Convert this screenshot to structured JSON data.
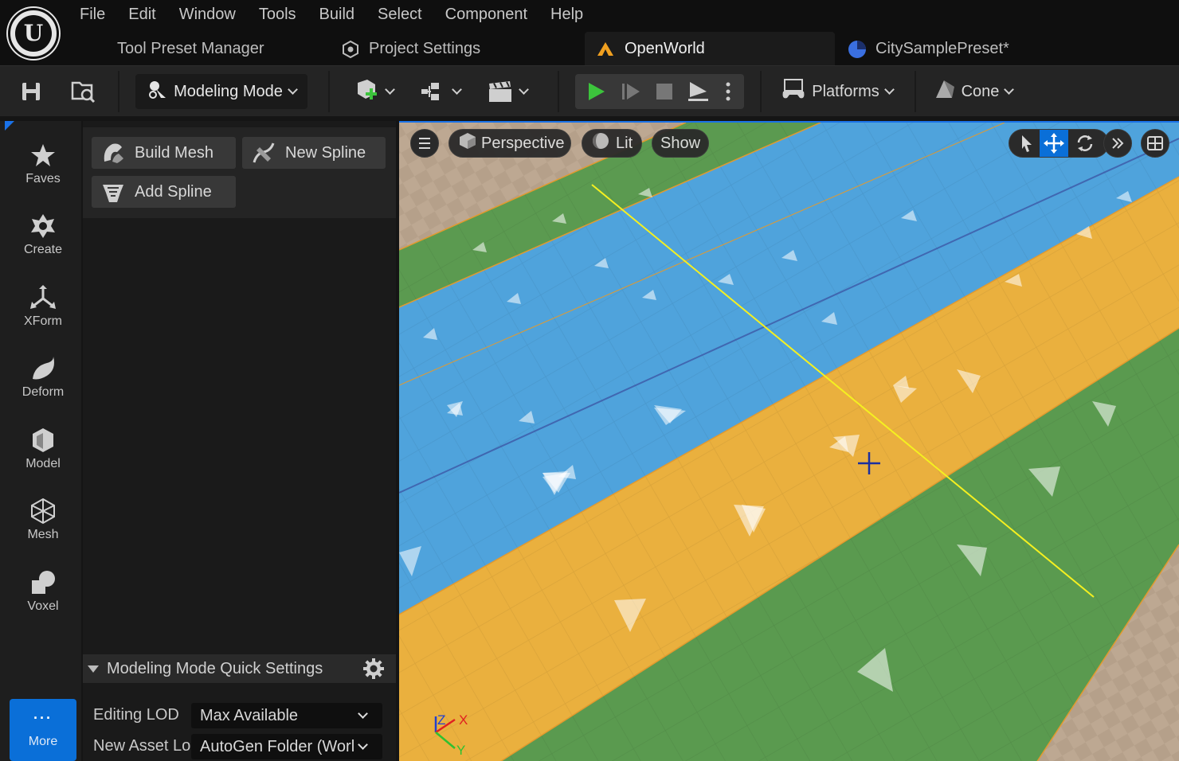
{
  "menu": [
    "File",
    "Edit",
    "Window",
    "Tools",
    "Build",
    "Select",
    "Component",
    "Help"
  ],
  "tabs": [
    {
      "label": "Tool Preset Manager",
      "icon": "none"
    },
    {
      "label": "Project Settings",
      "icon": "settings-cube-icon"
    },
    {
      "label": "OpenWorld",
      "icon": "level-icon",
      "active": true
    },
    {
      "label": "CitySamplePreset*",
      "icon": "preset-icon"
    }
  ],
  "toolbar": {
    "mode_label": "Modeling Mode",
    "platforms_label": "Platforms",
    "cone_label": "Cone",
    "play_color": "#3cc43c"
  },
  "categories": [
    {
      "label": "Faves",
      "icon": "star-icon"
    },
    {
      "label": "Create",
      "icon": "create-icon"
    },
    {
      "label": "XForm",
      "icon": "xform-icon"
    },
    {
      "label": "Deform",
      "icon": "deform-icon"
    },
    {
      "label": "Model",
      "icon": "model-icon"
    },
    {
      "label": "Mesh",
      "icon": "mesh-icon"
    },
    {
      "label": "Voxel",
      "icon": "voxel-icon"
    }
  ],
  "more_label": "More",
  "tools": [
    {
      "label": "Build Mesh"
    },
    {
      "label": "New Spline"
    },
    {
      "label": "Add Spline"
    }
  ],
  "quick_settings": {
    "title": "Modeling Mode Quick Settings",
    "editing_lod_label": "Editing LOD",
    "editing_lod_value": "Max Available",
    "new_asset_label": "New Asset Lo",
    "new_asset_value": "AutoGen Folder (Worl"
  },
  "viewport": {
    "perspective_label": "Perspective",
    "lit_label": "Lit",
    "show_label": "Show",
    "axis_z": "Z",
    "axis_x": "X",
    "axis_y": "Y"
  },
  "colors": {
    "accent": "#1a72e8",
    "road_blue": "#4fa3dc",
    "road_yellow": "#eab03e",
    "road_green": "#5a9a4f",
    "ground": "#b9a48e"
  }
}
